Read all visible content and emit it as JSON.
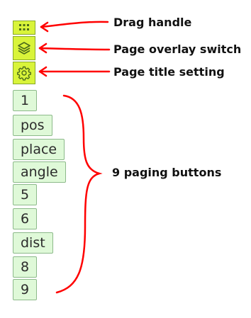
{
  "toolbar": {
    "drag_handle_icon": "grid-dots-icon",
    "overlay_switch_icon": "layers-icon",
    "title_setting_icon": "gear-icon",
    "accent_color": "#d9f43a"
  },
  "pages": [
    {
      "label": "1"
    },
    {
      "label": "pos"
    },
    {
      "label": "place"
    },
    {
      "label": "angle"
    },
    {
      "label": "5"
    },
    {
      "label": "6"
    },
    {
      "label": "dist"
    },
    {
      "label": "8"
    },
    {
      "label": "9"
    }
  ],
  "annotations": {
    "drag_handle": "Drag handle",
    "overlay_switch": "Page overlay switch",
    "title_setting": "Page title setting",
    "paging_buttons": "9 paging buttons",
    "arrow_color": "#ff0000"
  }
}
